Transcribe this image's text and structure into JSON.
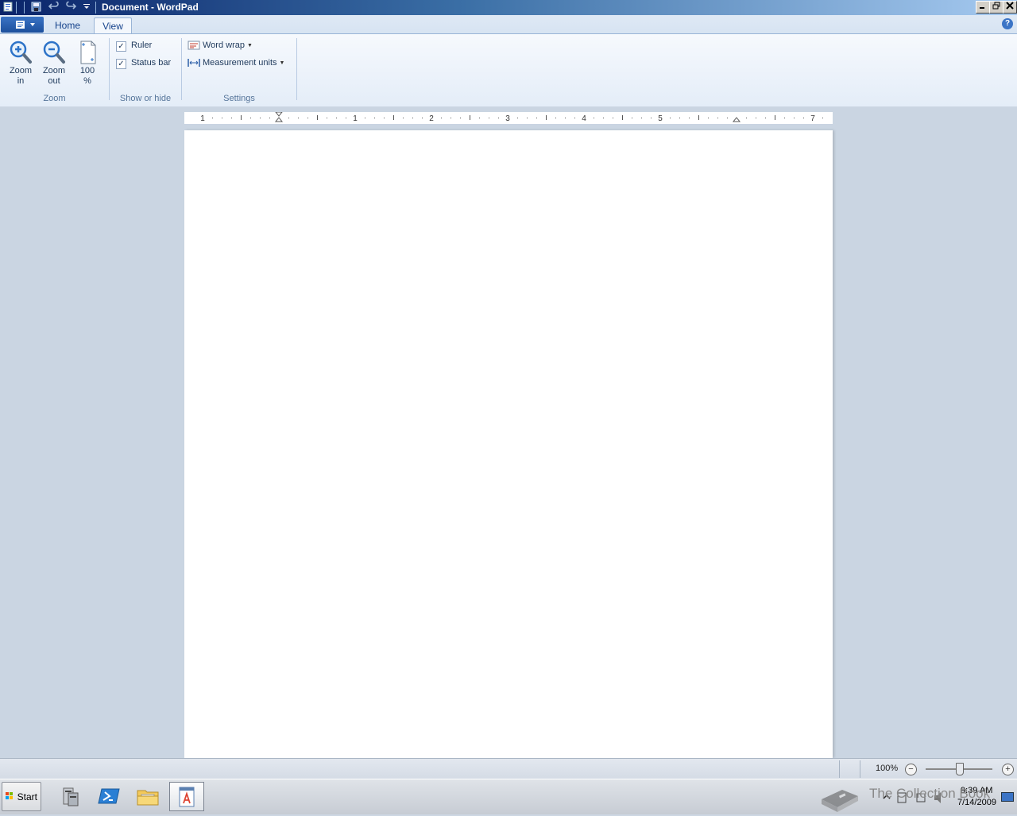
{
  "window": {
    "title": "Document - WordPad"
  },
  "ribbon": {
    "tabs": [
      {
        "label": "Home"
      },
      {
        "label": "View"
      }
    ],
    "groups": {
      "zoom": {
        "label": "Zoom",
        "zoom_in": {
          "line1": "Zoom",
          "line2": "in"
        },
        "zoom_out": {
          "line1": "Zoom",
          "line2": "out"
        },
        "hundred": {
          "line1": "100",
          "line2": "%"
        }
      },
      "show_or_hide": {
        "label": "Show or hide",
        "ruler": {
          "label": "Ruler",
          "checked": true
        },
        "status_bar": {
          "label": "Status bar",
          "checked": true
        }
      },
      "settings": {
        "label": "Settings",
        "word_wrap": "Word wrap",
        "measurement_units": "Measurement units"
      }
    }
  },
  "ruler": {
    "numbers": [
      "1",
      "1",
      "2",
      "3",
      "4",
      "5",
      "7"
    ]
  },
  "statusbar": {
    "zoom": "100%",
    "zoom_minus": "−",
    "zoom_plus": "+"
  },
  "taskbar": {
    "start_label": "Start",
    "time": "9:39 AM",
    "date": "7/14/2009"
  },
  "watermark": {
    "text": "The Collection Book"
  },
  "colors": {
    "accent": "#15428b",
    "ribbon_bg": "#e4edf8",
    "workspace": "#cad5e2"
  },
  "icons": [
    "wordpad-app-icon",
    "save-icon",
    "undo-icon",
    "redo-icon",
    "qat-dropdown-icon",
    "minimize-icon",
    "restore-icon",
    "close-icon",
    "help-icon",
    "zoom-in-icon",
    "zoom-out-icon",
    "page-100-icon",
    "word-wrap-icon",
    "measurement-units-icon",
    "server-manager-icon",
    "powershell-icon",
    "explorer-icon",
    "wordpad-taskbar-icon",
    "tray-flag-icon",
    "tray-network-icon",
    "tray-volume-icon",
    "show-desktop-icon"
  ]
}
